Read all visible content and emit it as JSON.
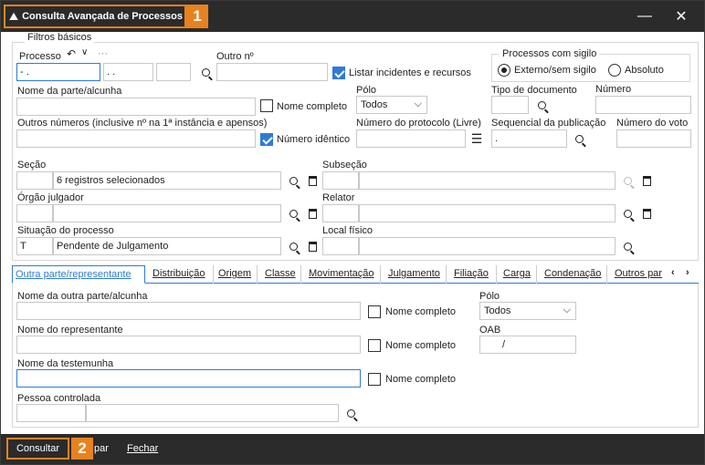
{
  "window": {
    "title": "Consulta Avançada de Processos",
    "badge1": "1",
    "badge2": "2",
    "minimize": "—",
    "close": "✕"
  },
  "filtros": {
    "group_title": "Filtros básicos",
    "processo_label": "Processo",
    "processo_value": "  -  .",
    "processo_seg2": " .  .",
    "outro_no_label": "Outro nº",
    "listar_incidentes_label": "Listar incidentes e recursos",
    "sigilo": {
      "title": "Processos com sigilo",
      "externo": "Externo/sem sigilo",
      "absoluto": "Absoluto"
    },
    "nome_parte_label": "Nome da parte/alcunha",
    "nome_completo_label": "Nome completo",
    "polo_label": "Pólo",
    "polo_value": "Todos",
    "tipo_documento_label": "Tipo de documento",
    "numero_label": "Número",
    "outros_numeros_label": "Outros números  (inclusive nº na 1ª instância e apensos)",
    "numero_identico_label": "Número idêntico",
    "numero_protocolo_label": "Número do protocolo (Livre)",
    "sequencial_label": "Sequencial da publicação",
    "sequencial_value": ".",
    "numero_voto_label": "Número do voto",
    "secao_label": "Seção",
    "secao_value": "6 registros selecionados",
    "subsecao_label": "Subseção",
    "orgao_label": "Órgão julgador",
    "relator_label": "Relator",
    "situacao_label": "Situação do processo",
    "situacao_code": "T",
    "situacao_value": "Pendente de Julgamento",
    "local_fisico_label": "Local físico"
  },
  "tabs": [
    "Outra parte/representante",
    "Distribuição",
    "Origem",
    "Classe",
    "Movimentação",
    "Julgamento",
    "Filiação",
    "Carga",
    "Condenação",
    "Outros par"
  ],
  "tab_panel": {
    "outra_parte_label": "Nome da outra parte/alcunha",
    "nome_completo_label": "Nome completo",
    "polo_label": "Pólo",
    "polo_value": "Todos",
    "representante_label": "Nome do representante",
    "oab_label": "OAB",
    "oab_value": "/",
    "testemunha_label": "Nome da testemunha",
    "pessoa_controlada_label": "Pessoa controlada"
  },
  "footer": {
    "consultar": "Consultar",
    "limpar": "par",
    "fechar": "Fechar"
  },
  "colors": {
    "accent": "#e8821e",
    "focus": "#2e7bd6",
    "titlebar": "#2b2b2b"
  }
}
